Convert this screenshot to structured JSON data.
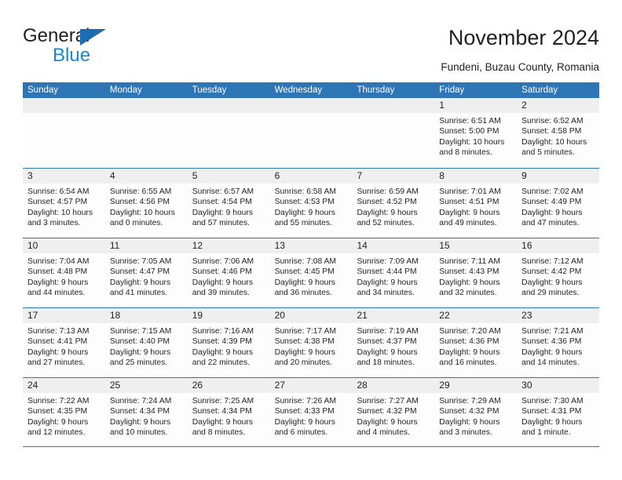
{
  "brand": {
    "line1": "General",
    "line2": "Blue",
    "triangle_color": "#1b6cb0"
  },
  "header": {
    "title": "November 2024",
    "subtitle": "Fundeni, Buzau County, Romania"
  },
  "theme": {
    "header_blue": "#2e75b6",
    "daynum_band": "#efefef",
    "text": "#231f20"
  },
  "weekdays": [
    "Sunday",
    "Monday",
    "Tuesday",
    "Wednesday",
    "Thursday",
    "Friday",
    "Saturday"
  ],
  "weeks": [
    [
      {
        "empty": true
      },
      {
        "empty": true
      },
      {
        "empty": true
      },
      {
        "empty": true
      },
      {
        "empty": true
      },
      {
        "day": "1",
        "sunrise": "Sunrise: 6:51 AM",
        "sunset": "Sunset: 5:00 PM",
        "daylight": "Daylight: 10 hours and 8 minutes."
      },
      {
        "day": "2",
        "sunrise": "Sunrise: 6:52 AM",
        "sunset": "Sunset: 4:58 PM",
        "daylight": "Daylight: 10 hours and 5 minutes."
      }
    ],
    [
      {
        "day": "3",
        "sunrise": "Sunrise: 6:54 AM",
        "sunset": "Sunset: 4:57 PM",
        "daylight": "Daylight: 10 hours and 3 minutes."
      },
      {
        "day": "4",
        "sunrise": "Sunrise: 6:55 AM",
        "sunset": "Sunset: 4:56 PM",
        "daylight": "Daylight: 10 hours and 0 minutes."
      },
      {
        "day": "5",
        "sunrise": "Sunrise: 6:57 AM",
        "sunset": "Sunset: 4:54 PM",
        "daylight": "Daylight: 9 hours and 57 minutes."
      },
      {
        "day": "6",
        "sunrise": "Sunrise: 6:58 AM",
        "sunset": "Sunset: 4:53 PM",
        "daylight": "Daylight: 9 hours and 55 minutes."
      },
      {
        "day": "7",
        "sunrise": "Sunrise: 6:59 AM",
        "sunset": "Sunset: 4:52 PM",
        "daylight": "Daylight: 9 hours and 52 minutes."
      },
      {
        "day": "8",
        "sunrise": "Sunrise: 7:01 AM",
        "sunset": "Sunset: 4:51 PM",
        "daylight": "Daylight: 9 hours and 49 minutes."
      },
      {
        "day": "9",
        "sunrise": "Sunrise: 7:02 AM",
        "sunset": "Sunset: 4:49 PM",
        "daylight": "Daylight: 9 hours and 47 minutes."
      }
    ],
    [
      {
        "day": "10",
        "sunrise": "Sunrise: 7:04 AM",
        "sunset": "Sunset: 4:48 PM",
        "daylight": "Daylight: 9 hours and 44 minutes."
      },
      {
        "day": "11",
        "sunrise": "Sunrise: 7:05 AM",
        "sunset": "Sunset: 4:47 PM",
        "daylight": "Daylight: 9 hours and 41 minutes."
      },
      {
        "day": "12",
        "sunrise": "Sunrise: 7:06 AM",
        "sunset": "Sunset: 4:46 PM",
        "daylight": "Daylight: 9 hours and 39 minutes."
      },
      {
        "day": "13",
        "sunrise": "Sunrise: 7:08 AM",
        "sunset": "Sunset: 4:45 PM",
        "daylight": "Daylight: 9 hours and 36 minutes."
      },
      {
        "day": "14",
        "sunrise": "Sunrise: 7:09 AM",
        "sunset": "Sunset: 4:44 PM",
        "daylight": "Daylight: 9 hours and 34 minutes."
      },
      {
        "day": "15",
        "sunrise": "Sunrise: 7:11 AM",
        "sunset": "Sunset: 4:43 PM",
        "daylight": "Daylight: 9 hours and 32 minutes."
      },
      {
        "day": "16",
        "sunrise": "Sunrise: 7:12 AM",
        "sunset": "Sunset: 4:42 PM",
        "daylight": "Daylight: 9 hours and 29 minutes."
      }
    ],
    [
      {
        "day": "17",
        "sunrise": "Sunrise: 7:13 AM",
        "sunset": "Sunset: 4:41 PM",
        "daylight": "Daylight: 9 hours and 27 minutes."
      },
      {
        "day": "18",
        "sunrise": "Sunrise: 7:15 AM",
        "sunset": "Sunset: 4:40 PM",
        "daylight": "Daylight: 9 hours and 25 minutes."
      },
      {
        "day": "19",
        "sunrise": "Sunrise: 7:16 AM",
        "sunset": "Sunset: 4:39 PM",
        "daylight": "Daylight: 9 hours and 22 minutes."
      },
      {
        "day": "20",
        "sunrise": "Sunrise: 7:17 AM",
        "sunset": "Sunset: 4:38 PM",
        "daylight": "Daylight: 9 hours and 20 minutes."
      },
      {
        "day": "21",
        "sunrise": "Sunrise: 7:19 AM",
        "sunset": "Sunset: 4:37 PM",
        "daylight": "Daylight: 9 hours and 18 minutes."
      },
      {
        "day": "22",
        "sunrise": "Sunrise: 7:20 AM",
        "sunset": "Sunset: 4:36 PM",
        "daylight": "Daylight: 9 hours and 16 minutes."
      },
      {
        "day": "23",
        "sunrise": "Sunrise: 7:21 AM",
        "sunset": "Sunset: 4:36 PM",
        "daylight": "Daylight: 9 hours and 14 minutes."
      }
    ],
    [
      {
        "day": "24",
        "sunrise": "Sunrise: 7:22 AM",
        "sunset": "Sunset: 4:35 PM",
        "daylight": "Daylight: 9 hours and 12 minutes."
      },
      {
        "day": "25",
        "sunrise": "Sunrise: 7:24 AM",
        "sunset": "Sunset: 4:34 PM",
        "daylight": "Daylight: 9 hours and 10 minutes."
      },
      {
        "day": "26",
        "sunrise": "Sunrise: 7:25 AM",
        "sunset": "Sunset: 4:34 PM",
        "daylight": "Daylight: 9 hours and 8 minutes."
      },
      {
        "day": "27",
        "sunrise": "Sunrise: 7:26 AM",
        "sunset": "Sunset: 4:33 PM",
        "daylight": "Daylight: 9 hours and 6 minutes."
      },
      {
        "day": "28",
        "sunrise": "Sunrise: 7:27 AM",
        "sunset": "Sunset: 4:32 PM",
        "daylight": "Daylight: 9 hours and 4 minutes."
      },
      {
        "day": "29",
        "sunrise": "Sunrise: 7:29 AM",
        "sunset": "Sunset: 4:32 PM",
        "daylight": "Daylight: 9 hours and 3 minutes."
      },
      {
        "day": "30",
        "sunrise": "Sunrise: 7:30 AM",
        "sunset": "Sunset: 4:31 PM",
        "daylight": "Daylight: 9 hours and 1 minute."
      }
    ]
  ]
}
